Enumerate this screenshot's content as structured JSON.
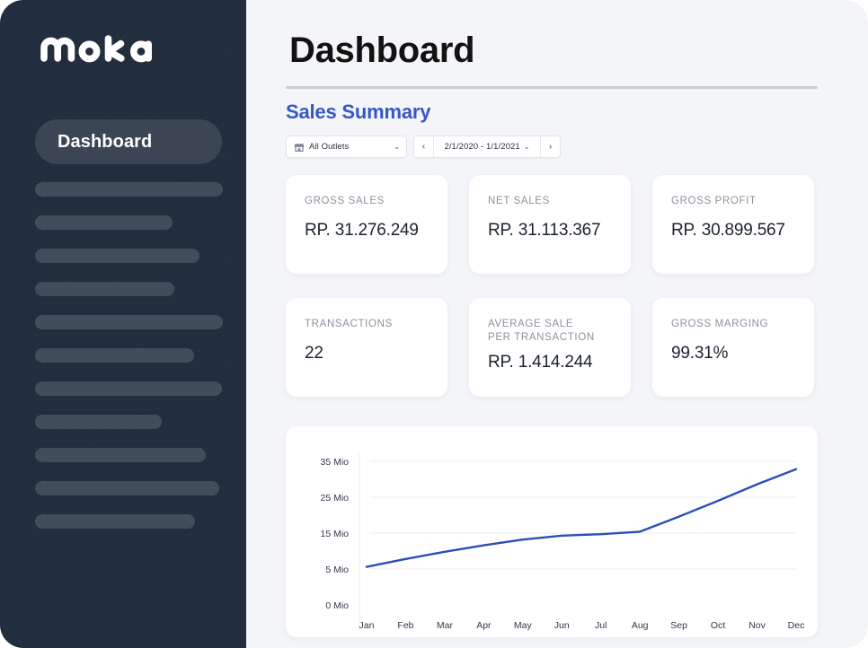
{
  "sidebar": {
    "logo_text": "moka",
    "active_item": {
      "label": "Dashboard"
    },
    "placeholder_widths": [
      209,
      153,
      183,
      155,
      209,
      177,
      208,
      141,
      190,
      205,
      178
    ]
  },
  "header": {
    "title": "Dashboard"
  },
  "section": {
    "title": "Sales Summary"
  },
  "filters": {
    "outlet": {
      "label": "All Outlets",
      "icon": "shop-icon",
      "caret": "⌄"
    },
    "date": {
      "prev": "‹",
      "next": "›",
      "range": "2/1/2020 - 1/1/2021",
      "caret": "⌄"
    }
  },
  "cards": [
    {
      "label": "GROSS SALES",
      "value": "RP. 31.276.249"
    },
    {
      "label": "NET SALES",
      "value": "RP. 31.113.367"
    },
    {
      "label": "GROSS PROFIT",
      "value": "RP. 30.899.567"
    },
    {
      "label": "TRANSACTIONS",
      "value": "22"
    },
    {
      "label": "AVERAGE SALE\nPER TRANSACTION",
      "label_line1": "AVERAGE SALE",
      "label_line2": "PER TRANSACTION",
      "value": "RP. 1.414.244"
    },
    {
      "label": "GROSS MARGING",
      "value": "99.31%"
    }
  ],
  "chart_data": {
    "type": "line",
    "title": "",
    "xlabel": "",
    "ylabel": "",
    "categories": [
      "Jan",
      "Feb",
      "Mar",
      "Apr",
      "May",
      "Jun",
      "Jul",
      "Aug",
      "Sep",
      "Oct",
      "Nov",
      "Dec"
    ],
    "ytick_labels": [
      "0 Mio",
      "5 Mio",
      "15 Mio",
      "25 Mio",
      "35 Mio"
    ],
    "ytick_values": [
      0,
      5,
      15,
      25,
      35
    ],
    "ylim": [
      0,
      40
    ],
    "grid": true,
    "legend": false,
    "line_color": "#2d4eb8",
    "series": [
      {
        "name": "Gross Sales",
        "values": [
          5.6,
          7.8,
          9.8,
          11.6,
          13.2,
          14.3,
          14.7,
          15.4,
          19.6,
          24.0,
          28.6,
          32.8
        ]
      }
    ]
  },
  "colors": {
    "sidebar_bg": "#222e3e",
    "accent_blue": "#3557c7",
    "line_blue": "#2d4eb8",
    "page_bg": "#f4f5f8",
    "card_bg": "#ffffff",
    "muted_text": "#8d929e"
  }
}
